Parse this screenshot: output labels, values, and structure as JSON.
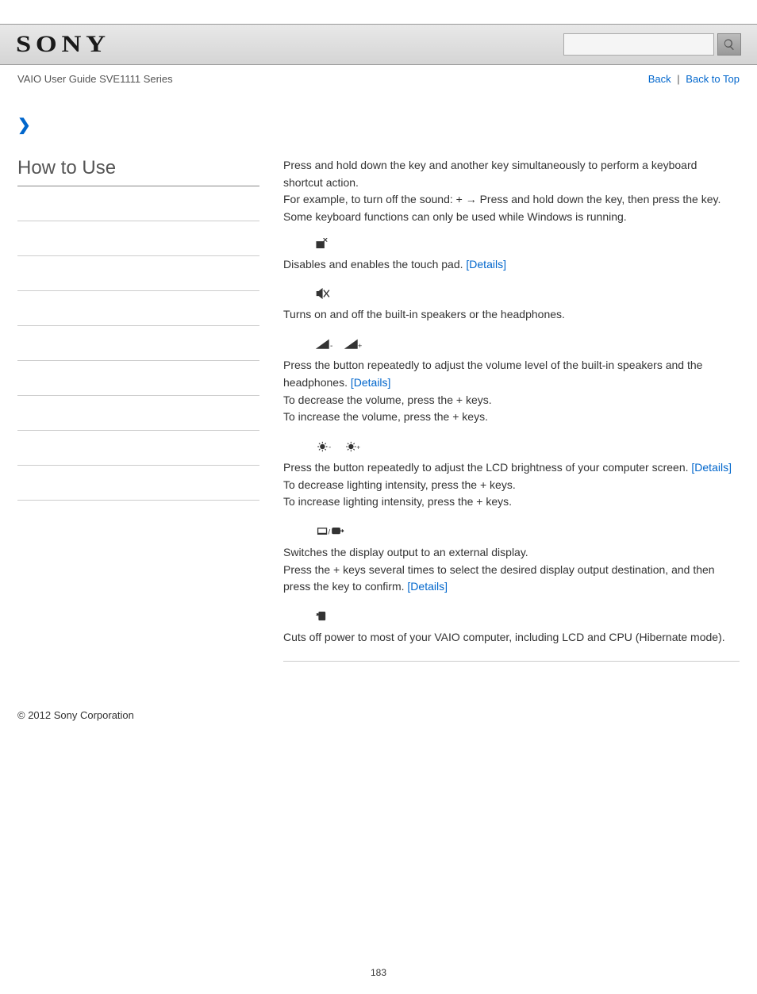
{
  "header": {
    "logo_text": "SONY",
    "search_placeholder": ""
  },
  "subheader": {
    "guide_title": "VAIO User Guide SVE1111 Series",
    "back_label": "Back",
    "back_to_top_label": "Back to Top"
  },
  "sidebar": {
    "title": "How to Use"
  },
  "content": {
    "intro_line1": "Press and hold down the        key and another key simultaneously to perform a keyboard shortcut action.",
    "intro_line2_a": "For example, to turn off the sound:        +        → Press and hold down the        key, then press the        key.",
    "intro_line3": "Some keyboard functions can only be used while Windows is running.",
    "touchpad_desc": "Disables and enables the touch pad. ",
    "speakers_desc": "Turns on and off the built-in speakers or the headphones.",
    "volume_desc": "Press the button repeatedly to adjust the volume level of the built-in speakers and the headphones. ",
    "volume_dec": "To decrease the volume, press the        +        keys.",
    "volume_inc": "To increase the volume, press the        +        keys.",
    "brightness_desc": "Press the button repeatedly to adjust the LCD brightness of your computer screen. ",
    "brightness_dec": "To decrease lighting intensity, press the        +        keys.",
    "brightness_inc": "To increase lighting intensity, press the        +        keys.",
    "display_desc1": "Switches the display output to an external display.",
    "display_desc2a": "Press the        +        keys several times to select the desired display output destination, and then press the            key to confirm. ",
    "hibernate_desc": "Cuts off power to most of your VAIO computer, including LCD and CPU (Hibernate mode).",
    "details_label": "[Details]"
  },
  "footer": {
    "copyright": "© 2012 Sony Corporation"
  },
  "page_number": "183"
}
